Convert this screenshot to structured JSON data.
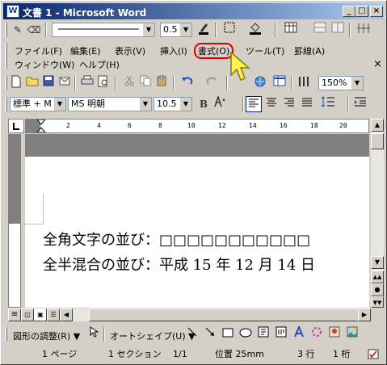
{
  "window": {
    "title": "文書 1 - Microsoft Word",
    "app_icon": "W"
  },
  "window_controls": {
    "minimize": "_",
    "maximize": "□",
    "close": "×"
  },
  "format_toolbar1": {
    "line_width": "0.5",
    "pencil": "✎",
    "eraser": "⌫"
  },
  "menu": {
    "items": [
      {
        "label": "ファイル(F)"
      },
      {
        "label": "編集(E)"
      },
      {
        "label": "表示(V)"
      },
      {
        "label": "挿入(I)"
      },
      {
        "label": "書式(O)"
      },
      {
        "label": "ツール(T)"
      },
      {
        "label": "罫線(A)"
      },
      {
        "label": "ウィンドウ(W)"
      },
      {
        "label": "ヘルプ(H)"
      }
    ],
    "close_glyph": "×"
  },
  "standard_toolbar": {
    "zoom": "150%"
  },
  "formatting_toolbar": {
    "style": "標準 + M",
    "font": "MS 明朝",
    "size": "10.5",
    "bold": "B"
  },
  "ruler": {
    "marks": [
      "2",
      "4",
      "6",
      "8",
      "10",
      "12",
      "14",
      "16",
      "18",
      "20"
    ]
  },
  "document": {
    "lines": [
      "全角文字の並び：□□□□□□□□□□□",
      "全半混合の並び：平成 15 年 12 月 14 日"
    ]
  },
  "drawing_toolbar": {
    "adjust": "図形の調整(R)",
    "autoshape": "オートシェイプ(U)"
  },
  "status_bar": {
    "page": "1 ページ",
    "section": "1 セクション",
    "page_of": "1/1",
    "position": "位置 25mm",
    "line": "3 行",
    "column": "1 桁"
  },
  "icons": [
    "app-word-icon",
    "pencil-icon",
    "eraser-icon",
    "new-doc-icon",
    "open-icon",
    "save-icon",
    "print-icon",
    "preview-icon",
    "cut-icon",
    "copy-icon",
    "paste-icon",
    "undo-icon",
    "redo-icon",
    "hyperlink-icon",
    "table-icon",
    "columns-icon",
    "bold-icon",
    "align-left-icon",
    "center-icon",
    "align-right-icon",
    "justify-icon",
    "line-spacing-icon",
    "indent-icon",
    "arrow-cursor-icon",
    "line-icon",
    "arrow-icon",
    "rectangle-icon",
    "oval-icon",
    "textbox-icon",
    "wordart-icon",
    "clipart-icon",
    "picture-icon"
  ],
  "colors": {
    "titlebar_start": "#0a246a",
    "titlebar_end": "#a6caf0",
    "highlight_ring": "#e00000",
    "cursor_fill": "#fff44f"
  }
}
